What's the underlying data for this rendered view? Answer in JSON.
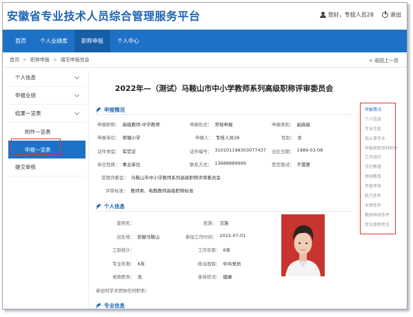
{
  "header": {
    "title": "安徽省专业技术人员综合管理服务平台",
    "user_greeting": "您好，专技人员28",
    "logout_label": "退出"
  },
  "nav": {
    "items": [
      {
        "label": "首页"
      },
      {
        "label": "个人业绩库"
      },
      {
        "label": "职称申报",
        "active": true
      },
      {
        "label": "个人中心"
      }
    ]
  },
  "breadcrumb": {
    "items": [
      "首页",
      "职称申报",
      "填写申报信息"
    ],
    "back_label": "< 返回上一页"
  },
  "sidebar": {
    "items": [
      {
        "label": "个人信息"
      },
      {
        "label": "申报业绩"
      },
      {
        "label": "结果一览表"
      },
      {
        "label": "附件一览表"
      },
      {
        "label": "申报一览表"
      },
      {
        "label": "提交审核"
      }
    ]
  },
  "main": {
    "heading": "2022年—（测试）马鞍山市中小学教师系列高级职称评审委员会",
    "section_declare": {
      "title": "申报情况",
      "fields": {
        "title_applied": {
          "label": "申报职称：",
          "value": "高级教师-中学教师"
        },
        "form": {
          "label": "申报形式：",
          "value": "常规申报"
        },
        "category": {
          "label": "申报类别：",
          "value": "副高级"
        },
        "unit": {
          "label": "申报单位：",
          "value": "郑塘小学"
        },
        "person": {
          "label": "申报人：",
          "value": "专技人员28"
        },
        "gender": {
          "label": "性别：",
          "value": "女"
        },
        "id_type": {
          "label": "证件类型：",
          "value": "军官证"
        },
        "id_no": {
          "label": "证件编号：",
          "value": "310101198303077437"
        },
        "birth": {
          "label": "出生日期：",
          "value": "1989-03-08"
        },
        "unit_nature": {
          "label": "单位性质：",
          "value": "事业单位"
        },
        "phone": {
          "label": "联系方式：",
          "value": "13688889999"
        },
        "exempt": {
          "label": "是否面试：",
          "value": "不需要"
        },
        "committee": {
          "label": "受理评委会：",
          "value": "马鞍山市中小学教师系列高级职称评审委员会"
        },
        "standard": {
          "label": "评审标准：",
          "value": "教师类、电教教师高级职称标准"
        }
      }
    },
    "section_personal": {
      "title": "个人信息",
      "fields": {
        "former_name": {
          "label": "曾用名：",
          "value": ""
        },
        "ethnicity": {
          "label": "民族：",
          "value": "汉族"
        },
        "birthplace": {
          "label": "出生地：",
          "value": "安徽马鞍山"
        },
        "work_start": {
          "label": "参加工作时间：",
          "value": "2015-07-01"
        },
        "work_years_label": {
          "label": "工龄统计：",
          "value": ""
        },
        "work_years": {
          "label": "工作年限：",
          "value": "6年"
        },
        "pro_years": {
          "label": "专业年限：",
          "value": "6年"
        },
        "politics": {
          "label": "政治面貌：",
          "value": "中共党员"
        },
        "duty": {
          "label": "党政职务：",
          "value": "无"
        },
        "health": {
          "label": "身体状况：",
          "value": "健康"
        },
        "society": {
          "label": "参加何学术团体任何职务：",
          "value": ""
        }
      }
    },
    "section_pro": {
      "title": "专业信息"
    }
  },
  "quicknav": {
    "items": [
      {
        "label": "申报情况",
        "active": true
      },
      {
        "label": "个人信息"
      },
      {
        "label": "专业信息"
      },
      {
        "label": "现从事专业"
      },
      {
        "label": "申报职称资料附件"
      },
      {
        "label": "工作经历"
      },
      {
        "label": "学历教育"
      },
      {
        "label": "继续教育"
      },
      {
        "label": "年度考核"
      },
      {
        "label": "能力条件"
      },
      {
        "label": "业绩条件"
      },
      {
        "label": "教研科研条件"
      },
      {
        "label": "单位推荐意见"
      }
    ]
  },
  "colors": {
    "brand_blue": "#1d72c7",
    "title_blue": "#1f64b4",
    "highlight_red": "#d9343a"
  }
}
